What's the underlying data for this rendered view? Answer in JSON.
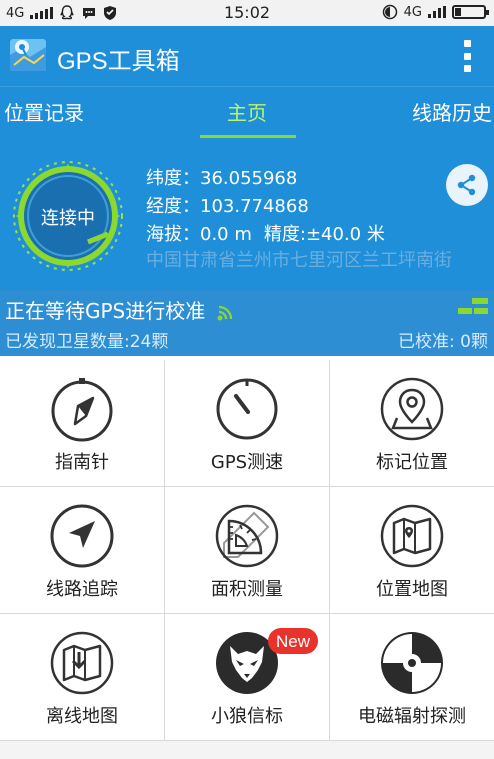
{
  "status_bar": {
    "network_left": "4G",
    "time": "15:02",
    "network_right": "4G"
  },
  "app": {
    "title": "GPS工具箱"
  },
  "tabs": [
    {
      "label": "位置记录",
      "active": false
    },
    {
      "label": "主页",
      "active": true
    },
    {
      "label": "线路历史",
      "active": false
    }
  ],
  "location": {
    "status": "连接中",
    "latitude_label": "纬度：",
    "latitude": "36.055968",
    "longitude_label": "经度：",
    "longitude": "103.774868",
    "altitude_label": "海拔：",
    "altitude": "0.0 m",
    "accuracy_label": "精度:",
    "accuracy": "±40.0 米",
    "address": "中国甘肃省兰州市七里河区兰工坪南街"
  },
  "gps": {
    "title": "正在等待GPS进行校准",
    "satellites": "已发现卫星数量:24颗",
    "calibrated": "已校准: 0颗"
  },
  "tools": [
    {
      "label": "指南针",
      "icon": "compass-icon"
    },
    {
      "label": "GPS测速",
      "icon": "speedometer-icon"
    },
    {
      "label": "标记位置",
      "icon": "map-pin-icon"
    },
    {
      "label": "线路追踪",
      "icon": "navigation-arrow-icon"
    },
    {
      "label": "面积测量",
      "icon": "protractor-icon"
    },
    {
      "label": "位置地图",
      "icon": "folded-map-icon"
    },
    {
      "label": "离线地图",
      "icon": "offline-map-icon"
    },
    {
      "label": "小狼信标",
      "icon": "wolf-icon",
      "badge": "New"
    },
    {
      "label": "电磁辐射探测",
      "icon": "radiation-icon"
    }
  ],
  "colors": {
    "primary": "#1e8fd8",
    "accent_green": "#8bd92e",
    "badge_red": "#e8332d",
    "icon_dark": "#333333"
  }
}
